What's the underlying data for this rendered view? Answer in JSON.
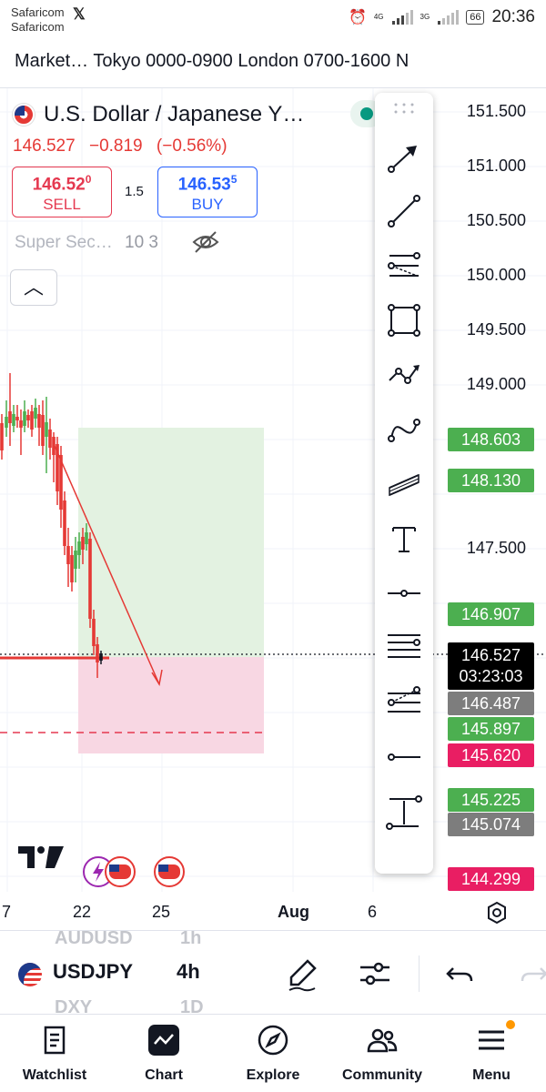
{
  "status_bar": {
    "carrier1": "Safaricom",
    "carrier2": "Safaricom",
    "network1": "4G",
    "network2": "3G",
    "battery": "66",
    "time": "20:36"
  },
  "session_header": "Market… Tokyo 0000-0900 London 0700-1600 N",
  "symbol": {
    "title": "U.S. Dollar / Japanese Y…",
    "last": "146.527",
    "change": "−0.819",
    "change_pct": "(−0.56%)"
  },
  "trade": {
    "sell_price_main": "146.52",
    "sell_price_sup": "0",
    "sell_label": "SELL",
    "spread": "1.5",
    "buy_price_main": "146.53",
    "buy_price_sup": "5",
    "buy_label": "BUY"
  },
  "indicator": {
    "name": "Super Sec…",
    "params": "10 3"
  },
  "price_axis": {
    "labels": [
      "151.500",
      "151.000",
      "150.500",
      "150.000",
      "149.500",
      "149.000",
      "147.500"
    ],
    "tags": [
      {
        "value": "148.603",
        "kind": "green"
      },
      {
        "value": "148.130",
        "kind": "green"
      },
      {
        "value": "146.907",
        "kind": "green"
      },
      {
        "value": "146.487",
        "kind": "grey"
      },
      {
        "value": "145.897",
        "kind": "green"
      },
      {
        "value": "145.620",
        "kind": "red"
      },
      {
        "value": "145.225",
        "kind": "green"
      },
      {
        "value": "145.074",
        "kind": "grey"
      },
      {
        "value": "144.299",
        "kind": "red"
      }
    ],
    "live_price": "146.527",
    "live_countdown": "03:23:03"
  },
  "time_axis": [
    "7",
    "22",
    "25",
    "Aug",
    "6"
  ],
  "tools": [
    "arrow-tool-icon",
    "trend-line-icon",
    "fib-retracement-icon",
    "rectangle-icon",
    "path-icon",
    "curve-icon",
    "parallel-channel-icon",
    "text-tool-icon",
    "horizontal-ray-icon",
    "horizontal-lines-icon",
    "pitchfork-icon",
    "horizontal-line-icon",
    "vertical-measure-icon"
  ],
  "symbol_bar": {
    "prev_symbol": "AUDUSD",
    "prev_interval": "1h",
    "symbol": "USDJPY",
    "interval": "4h",
    "next_symbol": "DXY",
    "next_interval": "1D"
  },
  "nav": [
    {
      "label": "Watchlist",
      "icon": "watchlist-icon"
    },
    {
      "label": "Chart",
      "icon": "chart-icon"
    },
    {
      "label": "Explore",
      "icon": "compass-icon"
    },
    {
      "label": "Community",
      "icon": "community-icon"
    },
    {
      "label": "Menu",
      "icon": "menu-icon"
    }
  ],
  "colors": {
    "down": "#e53935",
    "up": "#4caf50",
    "buy": "#2962ff",
    "profit_zone": "#e3f2e1",
    "loss_zone": "#f8d7e3"
  }
}
